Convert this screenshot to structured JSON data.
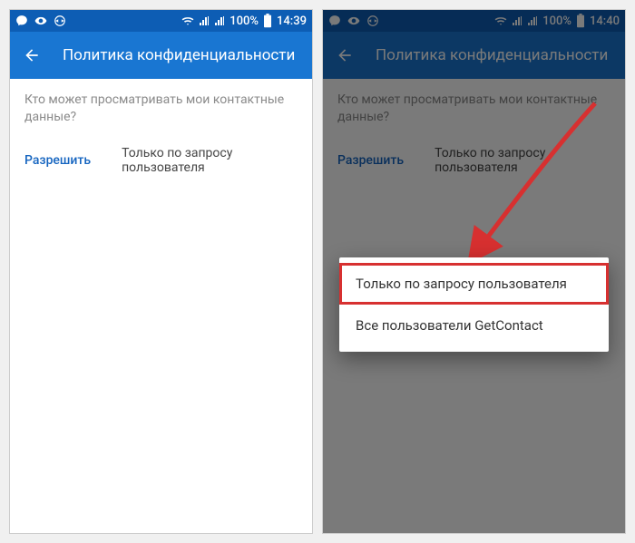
{
  "screen1": {
    "status": {
      "battery_pct": "100%",
      "time": "14:39"
    },
    "appbar": {
      "title": "Политика конфиденциальности"
    },
    "section_header": "Кто может просматривать мои контактные данные?",
    "setting": {
      "label": "Разрешить",
      "value": "Только по запросу пользователя"
    }
  },
  "screen2": {
    "status": {
      "battery_pct": "100%",
      "time": "14:40"
    },
    "appbar": {
      "title": "Политика конфиденциальности"
    },
    "section_header": "Кто может просматривать мои контактные данные?",
    "setting": {
      "label": "Разрешить",
      "value": "Только по запросу пользователя"
    },
    "dialog": {
      "option1": "Только по запросу пользователя",
      "option2": "Все пользователи GetContact"
    }
  },
  "colors": {
    "status_bg": "#0d5db4",
    "appbar_bg": "#1976d2",
    "accent": "#1665c0",
    "highlight": "#d73030"
  }
}
